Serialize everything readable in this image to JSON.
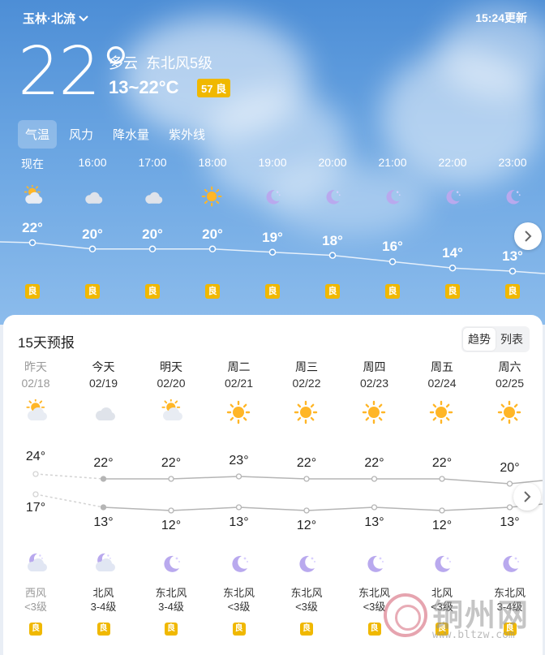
{
  "header": {
    "location": "玉林·北流",
    "update_time": "15:24更新"
  },
  "current": {
    "temp": "22°",
    "condition": "多云",
    "wind": "东北风5级",
    "range": "13~22°C",
    "aqi": "57 良"
  },
  "tabs": [
    "气温",
    "风力",
    "降水量",
    "紫外线"
  ],
  "hourly": [
    {
      "time": "现在",
      "icon": "sun-cloud-icon",
      "temp": 22,
      "temp_label": "22°",
      "quality": "良"
    },
    {
      "time": "16:00",
      "icon": "cloud-icon",
      "temp": 20,
      "temp_label": "20°",
      "quality": "良"
    },
    {
      "time": "17:00",
      "icon": "cloud-icon",
      "temp": 20,
      "temp_label": "20°",
      "quality": "良"
    },
    {
      "time": "18:00",
      "icon": "sun-icon",
      "temp": 20,
      "temp_label": "20°",
      "quality": "良"
    },
    {
      "time": "19:00",
      "icon": "moon-icon",
      "temp": 19,
      "temp_label": "19°",
      "quality": "良"
    },
    {
      "time": "20:00",
      "icon": "moon-icon",
      "temp": 18,
      "temp_label": "18°",
      "quality": "良"
    },
    {
      "time": "21:00",
      "icon": "moon-icon",
      "temp": 16,
      "temp_label": "16°",
      "quality": "良"
    },
    {
      "time": "22:00",
      "icon": "moon-icon",
      "temp": 14,
      "temp_label": "14°",
      "quality": "良"
    },
    {
      "time": "23:00",
      "icon": "moon-icon",
      "temp": 13,
      "temp_label": "13°",
      "quality": "良"
    }
  ],
  "forecast": {
    "title": "15天预报",
    "toggle": [
      "趋势",
      "列表"
    ],
    "days": [
      {
        "name": "昨天",
        "date": "02/18",
        "day_icon": "sun-cloud-icon",
        "high": 24,
        "high_label": "24°",
        "low": 17,
        "low_label": "17°",
        "night_icon": "moon-cloud-icon",
        "wind": "西风",
        "level": "<3级",
        "quality": "良",
        "past": true
      },
      {
        "name": "今天",
        "date": "02/19",
        "day_icon": "cloud-icon",
        "high": 22,
        "high_label": "22°",
        "low": 13,
        "low_label": "13°",
        "night_icon": "moon-cloud-icon",
        "wind": "北风",
        "level": "3-4级",
        "quality": "良",
        "past": false
      },
      {
        "name": "明天",
        "date": "02/20",
        "day_icon": "sun-cloud-icon",
        "high": 22,
        "high_label": "22°",
        "low": 12,
        "low_label": "12°",
        "night_icon": "moon-icon",
        "wind": "东北风",
        "level": "3-4级",
        "quality": "良",
        "past": false
      },
      {
        "name": "周二",
        "date": "02/21",
        "day_icon": "sun-icon",
        "high": 23,
        "high_label": "23°",
        "low": 13,
        "low_label": "13°",
        "night_icon": "moon-icon",
        "wind": "东北风",
        "level": "<3级",
        "quality": "良",
        "past": false
      },
      {
        "name": "周三",
        "date": "02/22",
        "day_icon": "sun-icon",
        "high": 22,
        "high_label": "22°",
        "low": 12,
        "low_label": "12°",
        "night_icon": "moon-icon",
        "wind": "东北风",
        "level": "<3级",
        "quality": "良",
        "past": false
      },
      {
        "name": "周四",
        "date": "02/23",
        "day_icon": "sun-icon",
        "high": 22,
        "high_label": "22°",
        "low": 13,
        "low_label": "13°",
        "night_icon": "moon-icon",
        "wind": "东北风",
        "level": "<3级",
        "quality": "良",
        "past": false
      },
      {
        "name": "周五",
        "date": "02/24",
        "day_icon": "sun-icon",
        "high": 22,
        "high_label": "22°",
        "low": 12,
        "low_label": "12°",
        "night_icon": "moon-icon",
        "wind": "北风",
        "level": "<3级",
        "quality": "良",
        "past": false
      },
      {
        "name": "周六",
        "date": "02/25",
        "day_icon": "sun-icon",
        "high": 20,
        "high_label": "20°",
        "low": 13,
        "low_label": "13°",
        "night_icon": "moon-icon",
        "wind": "东北风",
        "level": "3-4级",
        "quality": "良",
        "past": false
      }
    ]
  },
  "watermark": {
    "brand": "铜州网",
    "url": "www.bltzw.com"
  },
  "colors": {
    "sky_top": "#4d8ed6",
    "aqi_badge": "#f0b800",
    "line": "#c9c9c9"
  }
}
